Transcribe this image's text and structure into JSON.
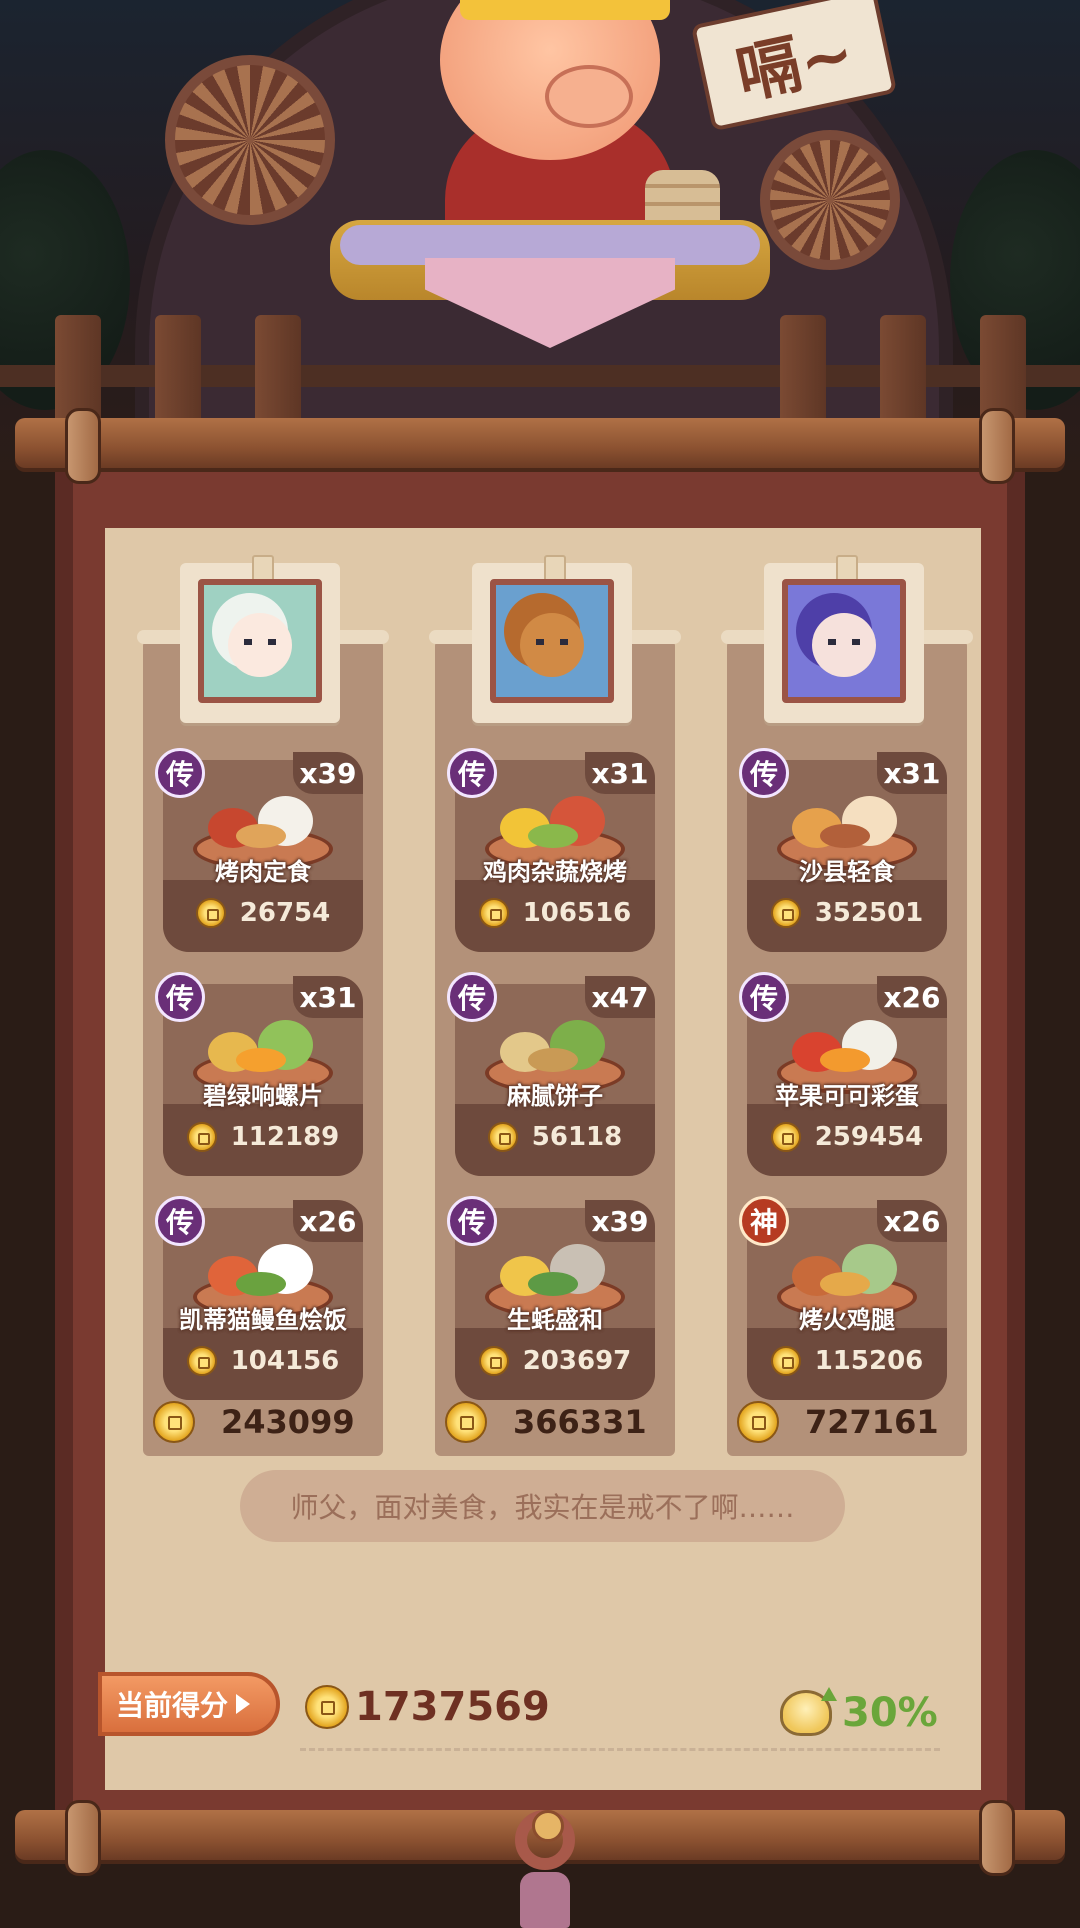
{
  "scene": {
    "speech_sign": "嗝~"
  },
  "columns": [
    {
      "portrait": {
        "name": "white-haired-character",
        "bg": "#9fd1c2",
        "skin": "#fbe9df",
        "hair": "#eef3ee"
      },
      "dishes": [
        {
          "rarity": "传",
          "count": "x39",
          "name": "烤肉定食",
          "price": "26754",
          "colors": [
            "#c7472f",
            "#f4f1ea",
            "#e0a45a"
          ]
        },
        {
          "rarity": "传",
          "count": "x31",
          "name": "碧绿响螺片",
          "price": "112189",
          "colors": [
            "#e7b84e",
            "#91c25a",
            "#f5a02e"
          ]
        },
        {
          "rarity": "传",
          "count": "x26",
          "name": "凯蒂猫鳗鱼烩饭",
          "price": "104156",
          "colors": [
            "#e0643a",
            "#ffffff",
            "#6aa23f"
          ]
        }
      ],
      "total": "243099"
    },
    {
      "portrait": {
        "name": "bear-character",
        "bg": "#6aa0cf",
        "skin": "#d18a45",
        "hair": "#b66a2e"
      },
      "dishes": [
        {
          "rarity": "传",
          "count": "x31",
          "name": "鸡肉杂蔬烧烤",
          "price": "106516",
          "colors": [
            "#f2c437",
            "#d5553a",
            "#8ab84b"
          ]
        },
        {
          "rarity": "传",
          "count": "x47",
          "name": "麻腻饼子",
          "price": "56118",
          "colors": [
            "#e3c88a",
            "#7daf4a",
            "#c99a55"
          ]
        },
        {
          "rarity": "传",
          "count": "x39",
          "name": "生蚝盛和",
          "price": "203697",
          "colors": [
            "#f0c54a",
            "#c9c0b4",
            "#5d9a45"
          ]
        }
      ],
      "total": "366331"
    },
    {
      "portrait": {
        "name": "purple-haired-character",
        "bg": "#7a78d8",
        "skin": "#f6e1dc",
        "hair": "#4e3fa8"
      },
      "dishes": [
        {
          "rarity": "传",
          "count": "x31",
          "name": "沙县轻食",
          "price": "352501",
          "colors": [
            "#e6a14c",
            "#f5dfc0",
            "#b2603a"
          ]
        },
        {
          "rarity": "传",
          "count": "x26",
          "name": "苹果可可彩蛋",
          "price": "259454",
          "colors": [
            "#d9432f",
            "#f2f0e8",
            "#f39a2e"
          ]
        },
        {
          "rarity": "神",
          "count": "x26",
          "name": "烤火鸡腿",
          "price": "115206",
          "colors": [
            "#c86a3a",
            "#a7c98a",
            "#e5a94a"
          ]
        }
      ],
      "total": "727161"
    }
  ],
  "quote": "师父，面对美食，我实在是戒不了啊……",
  "score": {
    "label": "当前得分",
    "value": "1737569",
    "bonus": "30%"
  }
}
